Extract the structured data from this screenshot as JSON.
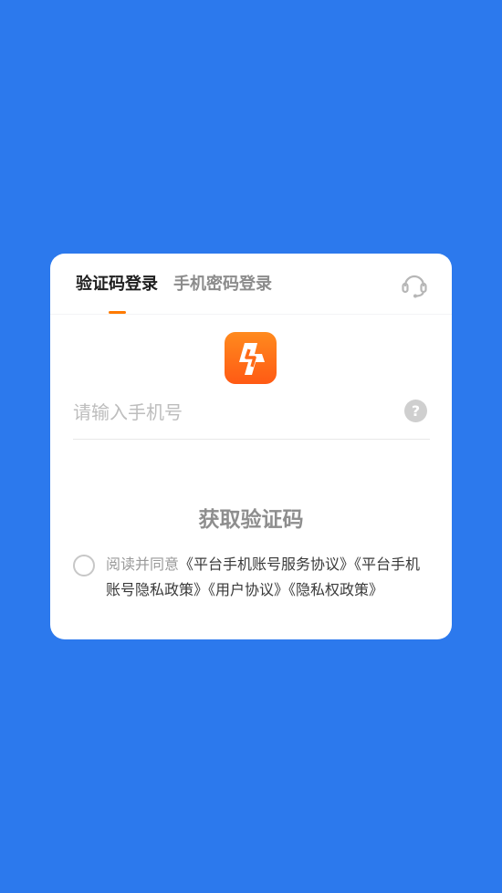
{
  "tabs": {
    "active": "验证码登录",
    "inactive": "手机密码登录"
  },
  "icons": {
    "support": "headset-icon",
    "logo": "lightning-app-logo",
    "help": "question-circle-icon"
  },
  "phone": {
    "placeholder": "请输入手机号",
    "value": ""
  },
  "help_icon_glyph": "?",
  "get_code_label": "获取验证码",
  "agreement": {
    "prefix": "阅读并同意",
    "links": [
      "《平台手机账号服务协议》",
      "《平台手机账号隐私政策》",
      "《用户协议》",
      "《隐私权政策》"
    ]
  },
  "colors": {
    "background": "#2c79ed",
    "accent": "#ff7a00"
  }
}
